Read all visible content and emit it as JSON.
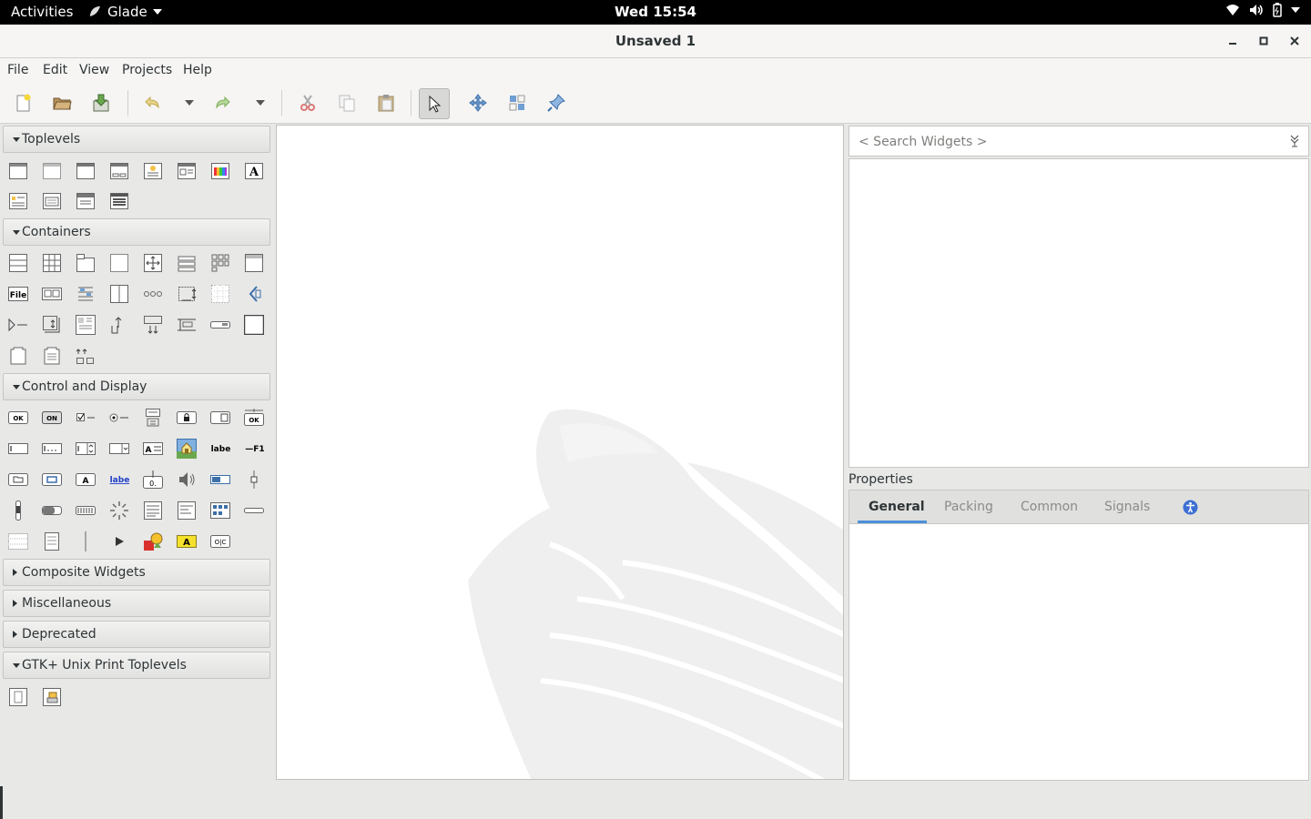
{
  "topbar": {
    "activities": "Activities",
    "app": "Glade",
    "clock": "Wed 15:54"
  },
  "window": {
    "title": "Unsaved 1"
  },
  "menu": {
    "file": "File",
    "edit": "Edit",
    "view": "View",
    "projects": "Projects",
    "help": "Help"
  },
  "palette": {
    "toplevels": "Toplevels",
    "containers": "Containers",
    "control": "Control and Display",
    "composite": "Composite Widgets",
    "misc": "Miscellaneous",
    "deprecated": "Deprecated",
    "print": "GTK+ Unix Print Toplevels",
    "icon_text": {
      "a": "A",
      "file": "File",
      "ok": "OK",
      "on": "ON",
      "label": "label",
      "f1": "—F1",
      "oc": "O|C"
    }
  },
  "search": {
    "placeholder": "< Search Widgets >"
  },
  "properties": {
    "label": "Properties",
    "tabs": {
      "general": "General",
      "packing": "Packing",
      "common": "Common",
      "signals": "Signals"
    }
  },
  "colors": {
    "accent": "#4a90d9",
    "tab_bg": "#e0e0de",
    "bg": "#e8e8e7"
  }
}
